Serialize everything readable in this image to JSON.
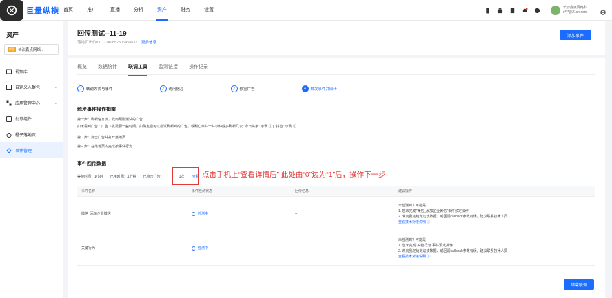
{
  "app": {
    "logo_text": "巨量纵横"
  },
  "nav": [
    "首页",
    "推广",
    "直播",
    "分析",
    "资产",
    "财务",
    "设置"
  ],
  "nav_active": 4,
  "user": {
    "name": "长沙鑫点网络科...",
    "email": "c***@21cn.com"
  },
  "sidebar": {
    "title": "资产",
    "account": {
      "tag": "代理",
      "name": "长沙鑫点网络..."
    },
    "items": [
      {
        "label": "视频库",
        "icon": "video-icon",
        "caret": false
      },
      {
        "label": "自定义人群包",
        "icon": "users-icon",
        "caret": true
      },
      {
        "label": "应用管理中心",
        "icon": "app-icon",
        "caret": true
      },
      {
        "label": "创意组件",
        "icon": "component-icon",
        "caret": false
      },
      {
        "label": "橙子落地页",
        "icon": "orange-icon",
        "caret": false
      },
      {
        "label": "事件管理",
        "icon": "event-icon",
        "caret": false,
        "active": true
      }
    ]
  },
  "header": {
    "title": "回传测试--11-19",
    "meta_label": "落地页出价ID：",
    "meta_id": "1749882306458632",
    "more": "更多信息",
    "add_button": "添加事件"
  },
  "tabs": [
    "概览",
    "数据统计",
    "联调工具",
    "监测链接",
    "操作记录"
  ],
  "tab_active": 2,
  "steps": [
    {
      "label": "联调方式与事件",
      "state": "done"
    },
    {
      "label": "访问信息",
      "state": "done"
    },
    {
      "label": "预览广告",
      "state": "done"
    },
    {
      "label": "触发事件并回传",
      "state": "current",
      "num": "4"
    }
  ],
  "guide": {
    "title": "触发事件操作指南",
    "line1": "第一步：刷新信息流，找到刚刚测试的广告",
    "line1_sub": "如无看到广告？广告下发需要一些时间，如确定后可以尝试刷新到的广告，或刷心条件一并以仲成多刷新几次 \"今日头条\" 示例 ⓘ | \"抖音\" 示例 ⓘ",
    "line2": "第二步：点击广告并打开落地页",
    "line3": "第三步：在落地页内完成按事件行为"
  },
  "event_data": {
    "title": "事件回传数据",
    "wait_label": "等待时间：1小时",
    "used_label": "已用时间：1分钟",
    "clicked_label": "已点击广告：",
    "clicked_value": "1次",
    "view_link": "查看"
  },
  "annotation": "点击手机上“查看详情后” 此处由“0”边为“1”后，操作下一步",
  "table": {
    "headers": [
      "事件名称",
      "事件检测状态",
      "回传信息",
      "建议操作"
    ],
    "rows": [
      {
        "name": "微信_添加企业微信",
        "status": "检测中",
        "info": "--",
        "sugg": [
          "未检测到？可能是",
          "1. 您未完成\"微信_添加企业微信\"事件预定操作",
          "2. 未向我定给定这该数据、或回调callback参数有误，建议联系技术人员",
          "查看技术对接说明 ⓘ"
        ]
      },
      {
        "name": "关键行为",
        "status": "检测中",
        "info": "--",
        "sugg": [
          "未检测到？可能是",
          "1. 您未完成\"关键行为\"事件预定操作",
          "2. 未向我定给定这该数据、或回调callback参数有误，建议联系技术人员",
          "查看技术对接说明 ⓘ"
        ]
      }
    ]
  },
  "finish_button": "结束联调",
  "colors": {
    "primary": "#1a6dff",
    "annotation": "#e53935"
  }
}
